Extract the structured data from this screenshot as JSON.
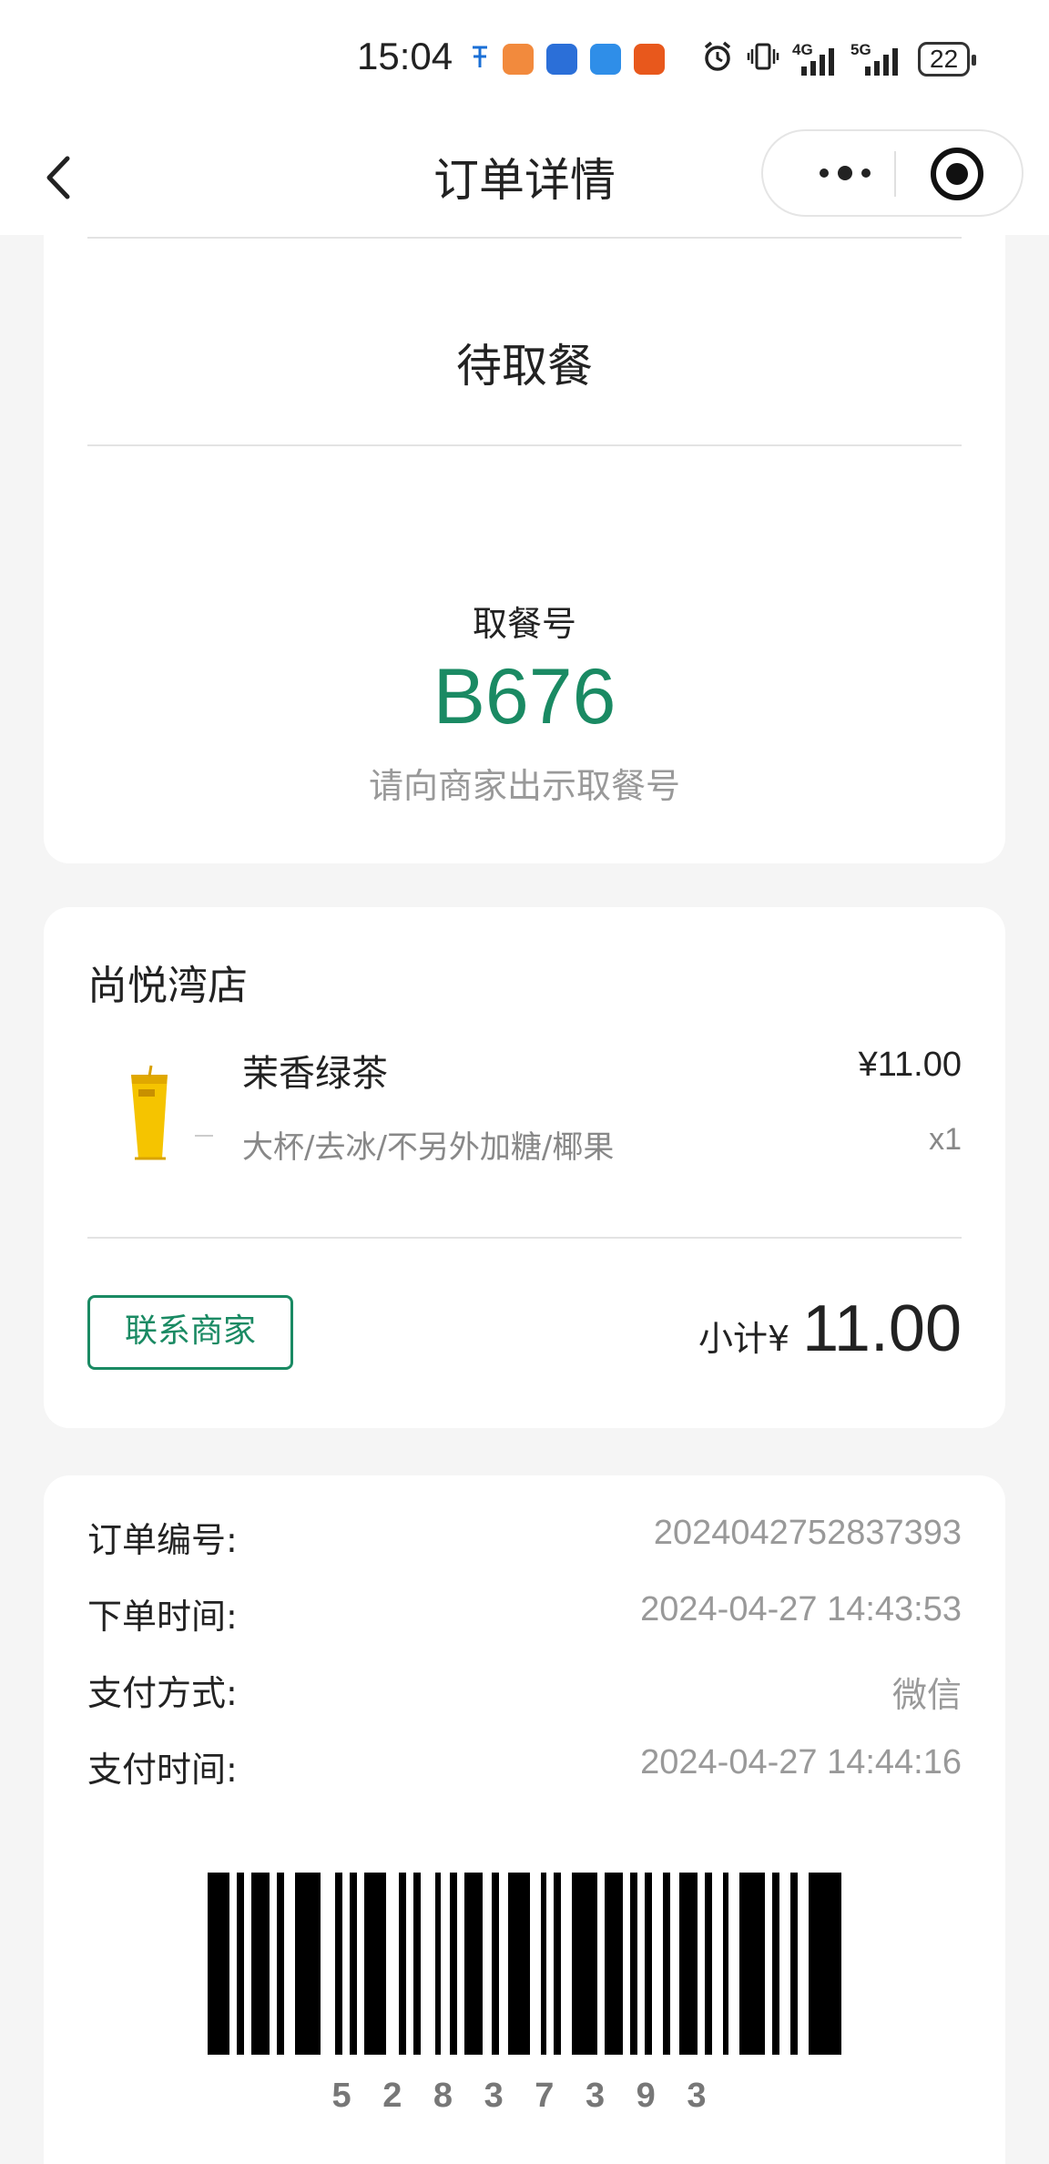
{
  "status_bar": {
    "time": "15:04",
    "battery": "22",
    "icons": [
      "notification-icon",
      "app-icon",
      "app-icon",
      "app-icon",
      "app-icon",
      "alarm-icon",
      "vibrate-icon",
      "signal-4g-icon",
      "signal-5g-icon",
      "battery-icon"
    ],
    "network_4g": "4G",
    "network_5g": "5G"
  },
  "nav": {
    "title": "订单详情"
  },
  "order_status": {
    "status": "待取餐",
    "pickup_label": "取餐号",
    "pickup_number": "B676",
    "pickup_hint": "请向商家出示取餐号",
    "accent_color": "#1a8a63"
  },
  "order": {
    "store_name": "尚悦湾店",
    "item": {
      "name": "茉香绿茶",
      "price": "¥11.00",
      "specs": "大杯/去冰/不另外加糖/椰果",
      "quantity": "x1"
    },
    "contact_button": "联系商家",
    "subtotal_label": "小计¥",
    "subtotal_amount": "11.00"
  },
  "info": {
    "rows": [
      {
        "label": "订单编号:",
        "value": "2024042752837393"
      },
      {
        "label": "下单时间:",
        "value": "2024-04-27 14:43:53"
      },
      {
        "label": "支付方式:",
        "value": "微信"
      },
      {
        "label": "支付时间:",
        "value": "2024-04-27 14:44:16"
      }
    ],
    "barcode_number": "5 2 8 3 7 3 9 3"
  }
}
